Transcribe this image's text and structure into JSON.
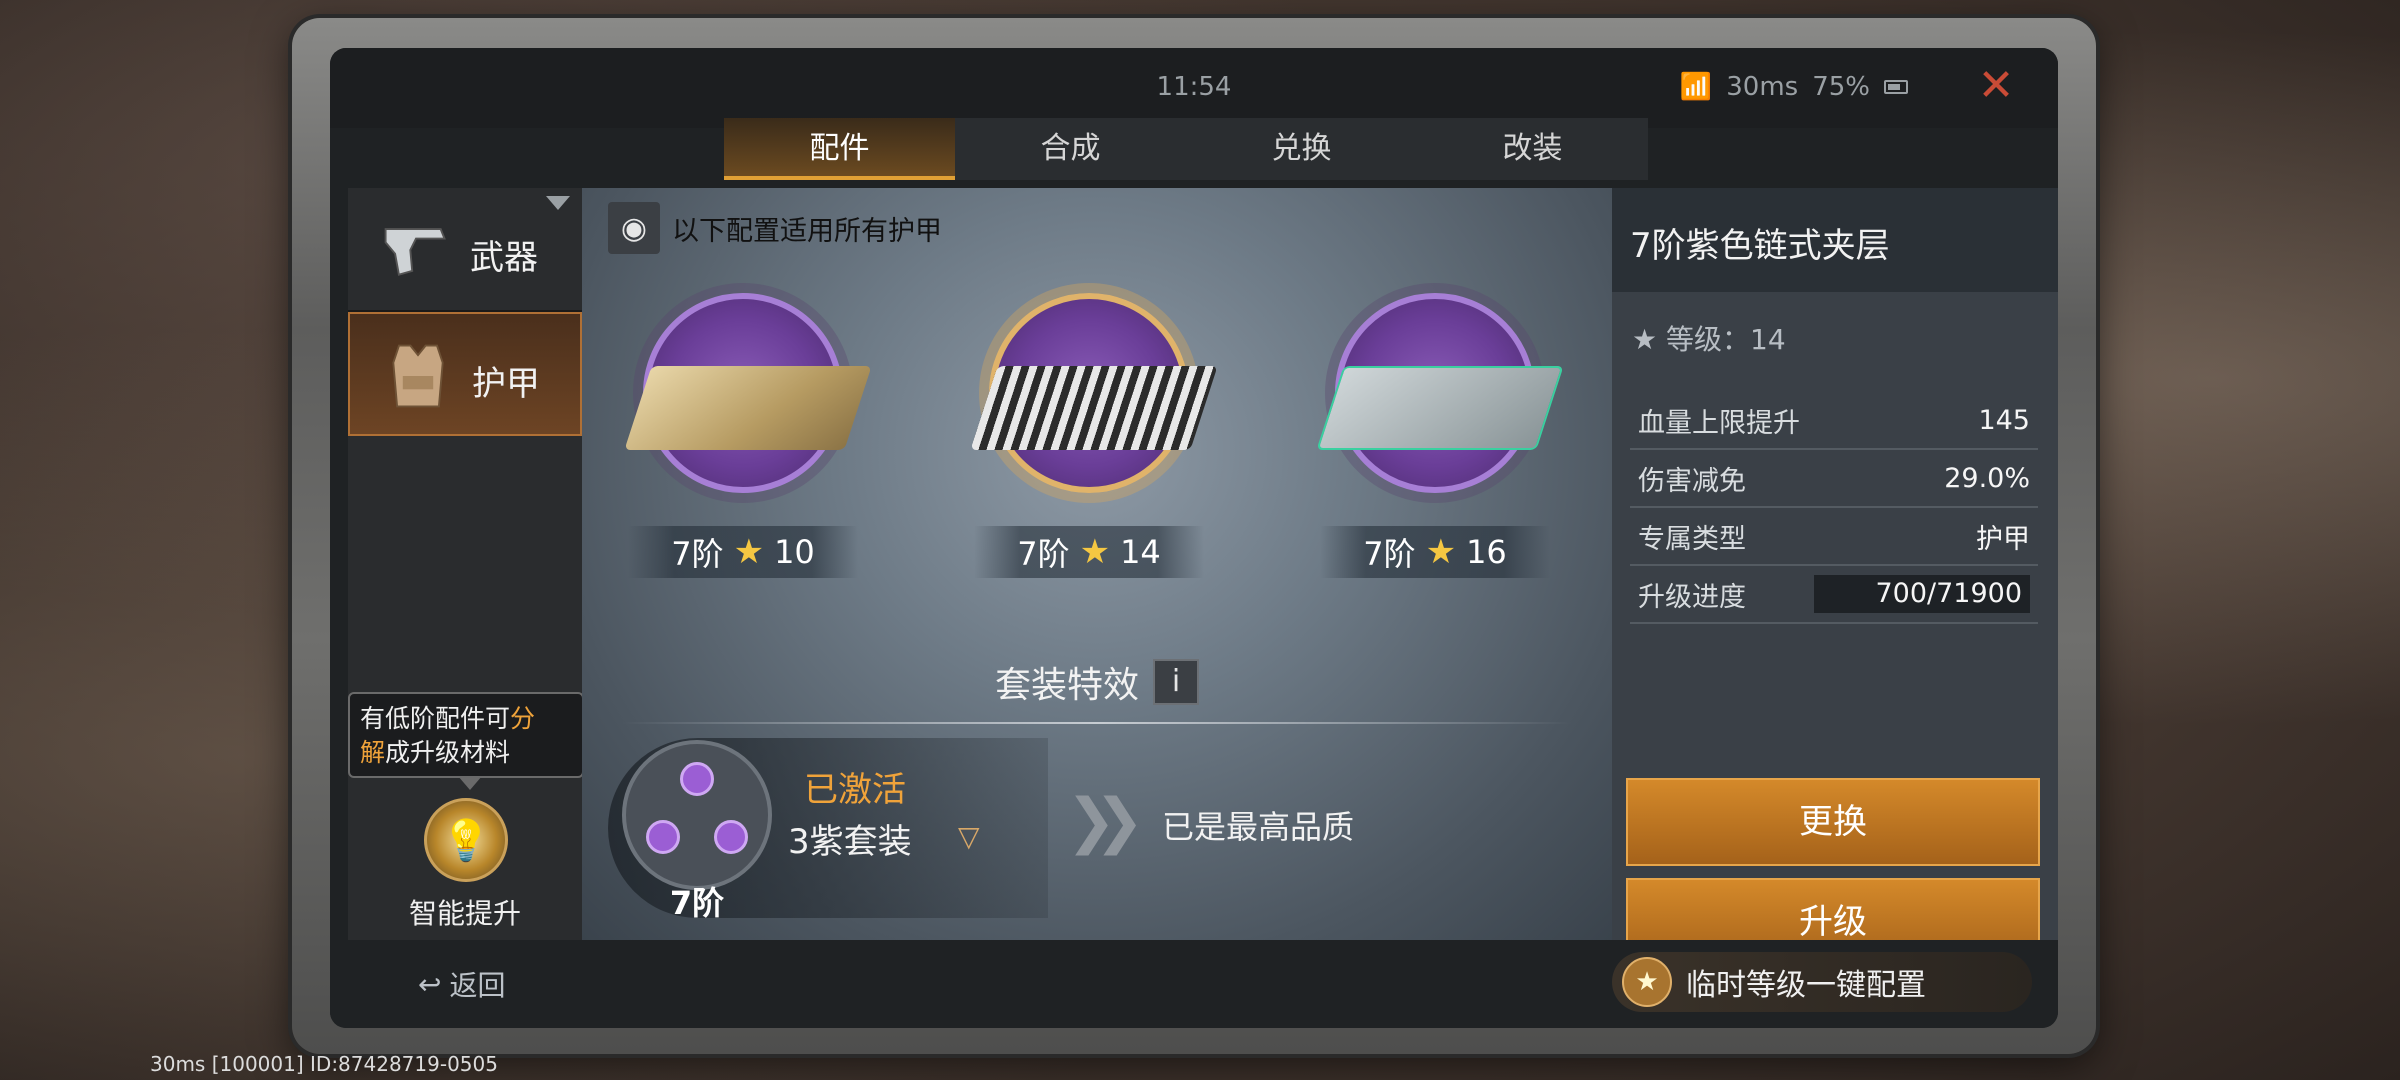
{
  "status": {
    "time": "11:54",
    "ping": "30ms",
    "battery": "75%"
  },
  "tabs": [
    {
      "label": "配件",
      "active": true
    },
    {
      "label": "合成"
    },
    {
      "label": "兑换"
    },
    {
      "label": "改装"
    }
  ],
  "sidebar": {
    "items": [
      {
        "label": "武器"
      },
      {
        "label": "护甲",
        "active": true
      }
    ]
  },
  "tooltip": {
    "part1": "有低阶配件可",
    "highlight1": "分",
    "highlight2": "解",
    "part2": "成升级材料"
  },
  "smart_upgrade": {
    "label": "智能提升"
  },
  "main": {
    "note": "以下配置适用所有护甲",
    "slots": [
      {
        "tier": "7阶",
        "stars": "10"
      },
      {
        "tier": "7阶",
        "stars": "14"
      },
      {
        "tier": "7阶",
        "stars": "16"
      }
    ],
    "set_effect_title": "套装特效",
    "set": {
      "status": "已激活",
      "name": "3紫套装",
      "tier": "7阶"
    },
    "max_quality": "已是最高品质"
  },
  "detail": {
    "title": "7阶紫色链式夹层",
    "level_label": "等级：14",
    "stats": [
      {
        "label": "血量上限提升",
        "value": "145"
      },
      {
        "label": "伤害减免",
        "value": "29.0%"
      },
      {
        "label": "专属类型",
        "value": "护甲"
      }
    ],
    "progress_label": "升级进度",
    "progress_value": "700/71900",
    "replace_button": "更换",
    "upgrade_button": "升级"
  },
  "bottom": {
    "back": "返回",
    "quick_config": "临时等级一键配置"
  },
  "overlay_text": "30ms  [100001] ID:87428719-0505",
  "colors": {
    "accent": "#e0a035",
    "purple": "#8a5cb8",
    "highlight_text": "#f0a33a"
  }
}
